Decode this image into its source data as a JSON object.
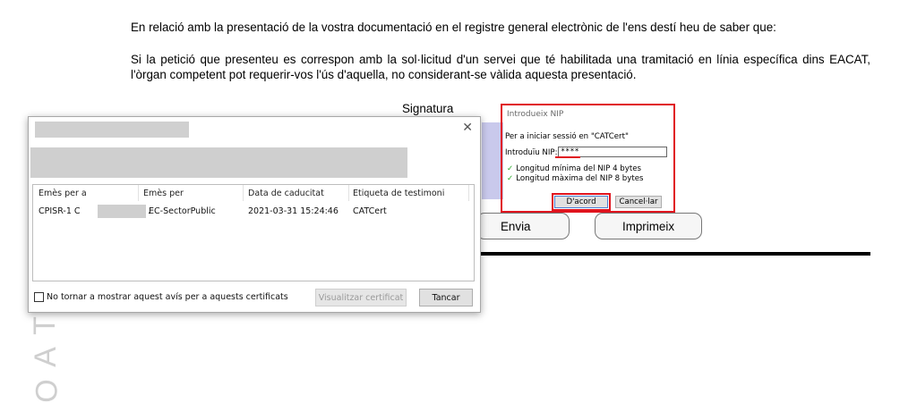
{
  "document": {
    "paragraph1": "En relació amb la presentació de la vostra documentació en el registre general electrònic de l'ens destí heu de saber que:",
    "paragraph2": "Si la petició que presenteu es correspon amb la sol·licitud d'un servei que té habilitada una tramitació en línia específica dins EACAT, l'òrgan competent pot requerir-vos l'ús d'aquella, no considerant-se vàlida aquesta presentació.",
    "signatura_label": "Signatura",
    "send_button": "Envia",
    "print_button": "Imprimeix",
    "side_letters": [
      "T",
      "A",
      "O"
    ]
  },
  "cert_dialog": {
    "close_glyph": "✕",
    "columns": [
      "Emès per a",
      "Emès per",
      "Data de caducitat",
      "Etiqueta de testimoni"
    ],
    "rows": [
      {
        "issued_to": "CPISR-1 C",
        "issued_to_suffix": ".",
        "issued_by": "EC-SectorPublic",
        "expiry": "2021-03-31 15:24:46",
        "token_label": "CATCert"
      }
    ],
    "checkbox_label": "No tornar a mostrar aquest avís per a aquests certificats",
    "view_button": "Visualitzar certificat",
    "close_button": "Tancar"
  },
  "nip_dialog": {
    "title": "Introdueix NIP",
    "message": "Per a iniciar sessió en \"CATCert\"",
    "nip_label": "Introduïu NIP:",
    "nip_value": "****",
    "rules": [
      "Longitud mínima del NIP 4 bytes",
      "Longitud màxima del NIP 8 bytes"
    ],
    "ok_button": "D'acord",
    "cancel_button": "Cancel·lar"
  },
  "colors": {
    "highlight_red": "#e0141e",
    "check_green": "#1aa31a",
    "panel_blue": "#c9c9ec"
  }
}
